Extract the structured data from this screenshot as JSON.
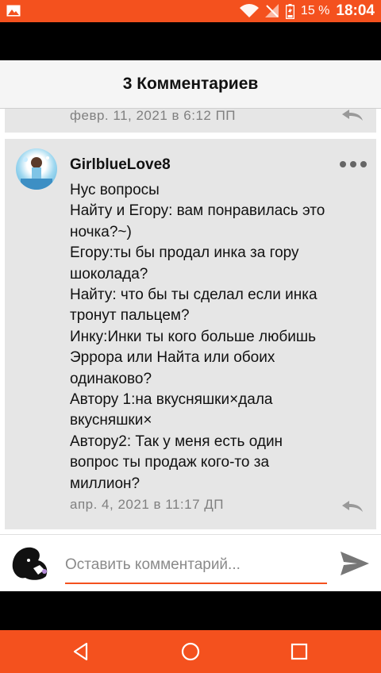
{
  "status_bar": {
    "battery_percent": "15 %",
    "time": "18:04",
    "icons": [
      "gallery-icon",
      "wifi-icon",
      "signal-icon",
      "battery-icon"
    ]
  },
  "header": {
    "title": "3 Комментариев"
  },
  "previous_comment": {
    "timestamp": "февр. 11, 2021 в 6:12 ПП"
  },
  "comment": {
    "username": "GirlblueLove8",
    "lines": [
      "Нус  вопросы",
      "Найту и Егору: вам понравилась это",
      "ночка?~)",
      "Егору:ты бы продал инка за гору",
      "шоколада?",
      "Найту: что бы ты сделал если инка",
      "тронут пальцем?",
      "Инку:Инки ты кого больше любишь",
      "Эррора или Найта или обоих",
      "одинаково?",
      "Автору 1:на вкусняшки×дала",
      "вкусняшки×",
      "Автору2: Так у меня есть один",
      "вопрос ты продаж кого-то за",
      "миллион?"
    ],
    "timestamp": "апр. 4, 2021 в 11:17 ДП"
  },
  "input": {
    "placeholder": "Оставить комментарий...",
    "value": ""
  },
  "colors": {
    "accent": "#f4511e",
    "comment_bg": "#e6e6e6",
    "header_bg": "#f5f5f5"
  }
}
